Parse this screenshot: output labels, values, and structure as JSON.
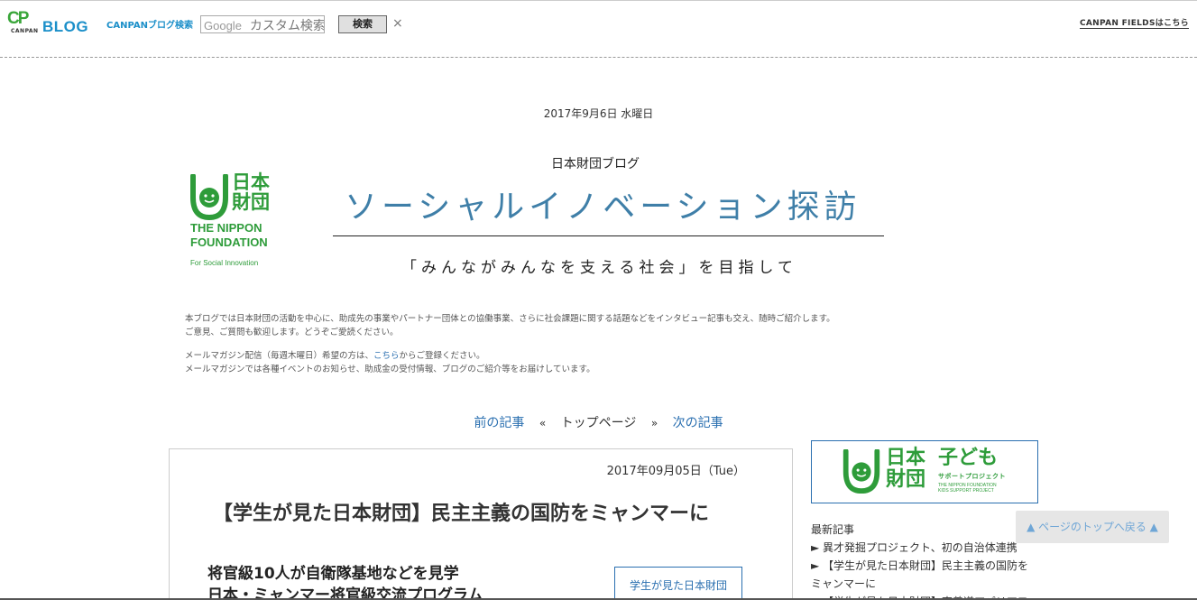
{
  "toolbar": {
    "logo_mark": "CP",
    "logo_small": "CANPAN",
    "logo_blog": "BLOG",
    "search_label": "CANPANブログ検索",
    "search_google": "Google",
    "search_placeholder": "カスタム検索",
    "search_button": "検索",
    "close_glyph": "×",
    "fields_link": "CANPAN FIELDSはこちら"
  },
  "header": {
    "date": "2017年9月6日 水曜日",
    "blog_subtitle": "日本財団ブログ",
    "banner_title": "ソーシャルイノベーション探訪",
    "banner_tagline": "「みんながみんなを支える社会」を目指して",
    "logo_kanji": "日本財団",
    "logo_name_line1": "THE NIPPON",
    "logo_name_line2": "FOUNDATION",
    "logo_social": "For Social Innovation"
  },
  "description": {
    "line1": "本ブログでは日本財団の活動を中心に、助成先の事業やパートナー団体との協働事業、さらに社会課題に関する話題などをインタビュー記事も交え、随時ご紹介します。",
    "line2": "ご意見、ご質問も歓迎します。どうぞご愛読ください。",
    "line3_pre": "メールマガジン配信（毎週木曜日）希望の方は、",
    "line3_link": "こちら",
    "line3_post": "からご登録ください。",
    "line4": "メールマガジンでは各種イベントのお知らせ、助成金の受付情報、ブログのご紹介等をお届けしています。"
  },
  "pager": {
    "prev": "前の記事",
    "sep1": "«",
    "top": "トップページ",
    "sep2": "»",
    "next": "次の記事"
  },
  "article": {
    "date": "2017年09月05日（Tue）",
    "title": "【学生が見た日本財団】民主主義の国防をミャンマーに",
    "heading_line1": "将官級10人が自衛隊基地などを見学",
    "heading_line2": "日本・ミャンマー将官級交流プログラム",
    "tag": "学生が見た日本財団"
  },
  "sidebar": {
    "kids_kanji": "日本財団",
    "kids_kodomo": "子ども",
    "kids_sub": "サポートプロジェクト",
    "kids_en_line1": "THE NIPPON FOUNDATION",
    "kids_en_line2": "KIDS SUPPORT PROJECT",
    "recent_heading": "最新記事",
    "recent_items": [
      "► 異才発掘プロジェクト、初の自治体連携",
      "► 【学生が見た日本財団】民主主義の国防をミャンマーに",
      "► 【学生が見た日本財団】東善道アパリアフ"
    ]
  },
  "back_to_top": "▲ ページのトップへ戻る ▲",
  "colors": {
    "brand_green": "#2e9c3a",
    "link_blue": "#2a6fb0",
    "title_blue": "#3f7fa8"
  }
}
